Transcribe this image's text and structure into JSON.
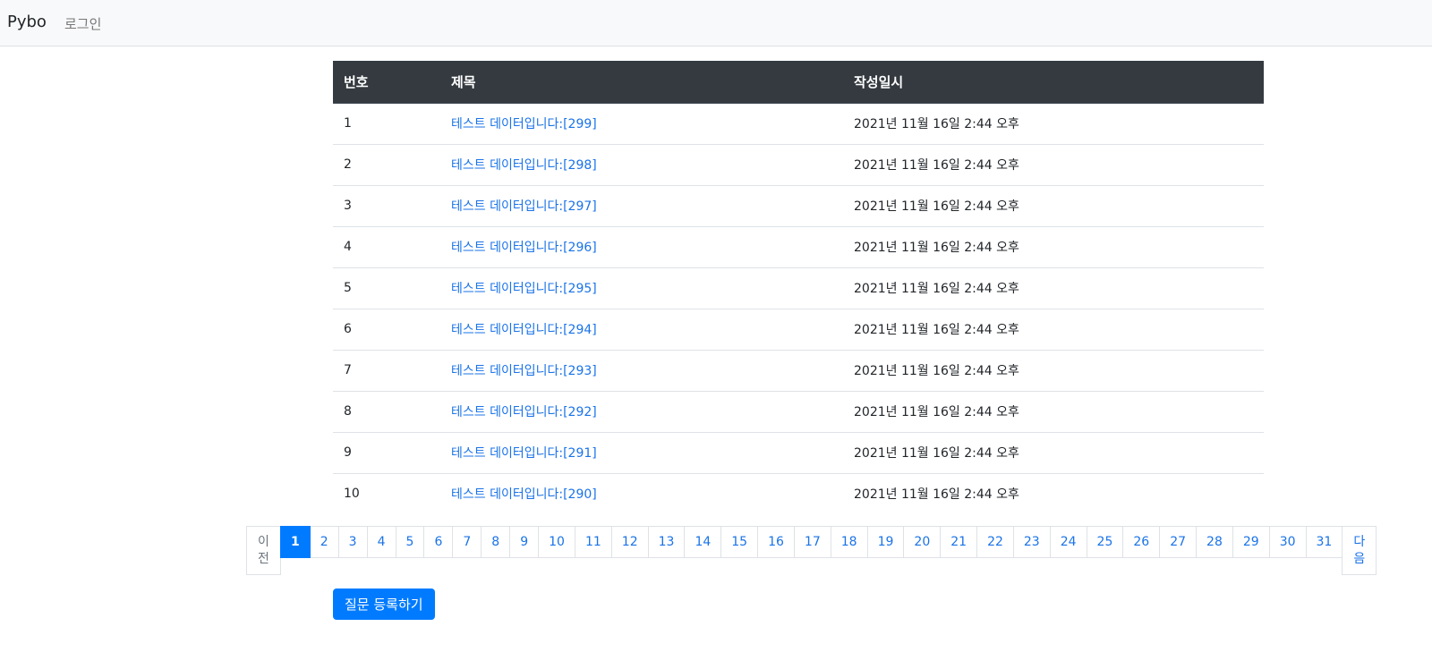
{
  "navbar": {
    "brand": "Pybo",
    "login_label": "로그인"
  },
  "table": {
    "headers": [
      "번호",
      "제목",
      "작성일시"
    ],
    "rows": [
      {
        "num": "1",
        "title": "테스트 데이터입니다:[299]",
        "date": "2021년 11월 16일 2:44 오후"
      },
      {
        "num": "2",
        "title": "테스트 데이터입니다:[298]",
        "date": "2021년 11월 16일 2:44 오후"
      },
      {
        "num": "3",
        "title": "테스트 데이터입니다:[297]",
        "date": "2021년 11월 16일 2:44 오후"
      },
      {
        "num": "4",
        "title": "테스트 데이터입니다:[296]",
        "date": "2021년 11월 16일 2:44 오후"
      },
      {
        "num": "5",
        "title": "테스트 데이터입니다:[295]",
        "date": "2021년 11월 16일 2:44 오후"
      },
      {
        "num": "6",
        "title": "테스트 데이터입니다:[294]",
        "date": "2021년 11월 16일 2:44 오후"
      },
      {
        "num": "7",
        "title": "테스트 데이터입니다:[293]",
        "date": "2021년 11월 16일 2:44 오후"
      },
      {
        "num": "8",
        "title": "테스트 데이터입니다:[292]",
        "date": "2021년 11월 16일 2:44 오후"
      },
      {
        "num": "9",
        "title": "테스트 데이터입니다:[291]",
        "date": "2021년 11월 16일 2:44 오후"
      },
      {
        "num": "10",
        "title": "테스트 데이터입니다:[290]",
        "date": "2021년 11월 16일 2:44 오후"
      }
    ]
  },
  "pagination": {
    "prev_label": [
      "이",
      "전"
    ],
    "next_label": [
      "다",
      "음"
    ],
    "pages": [
      "1",
      "2",
      "3",
      "4",
      "5",
      "6",
      "7",
      "8",
      "9",
      "10",
      "11",
      "12",
      "13",
      "14",
      "15",
      "16",
      "17",
      "18",
      "19",
      "20",
      "21",
      "22",
      "23",
      "24",
      "25",
      "26",
      "27",
      "28",
      "29",
      "30",
      "31"
    ],
    "current_page": "1"
  },
  "actions": {
    "create_question_label": "질문 등록하기"
  },
  "colors": {
    "accent": "#007bff",
    "header_bg": "#343a40",
    "link": "#1a73e8"
  }
}
